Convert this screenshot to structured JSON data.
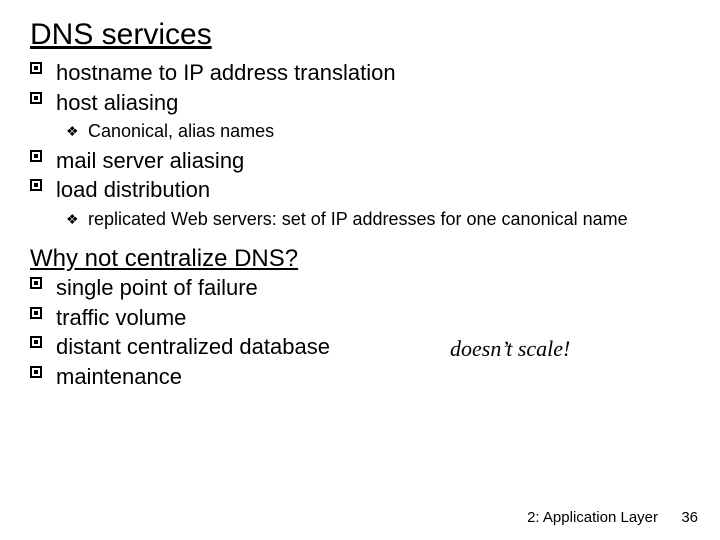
{
  "headings": {
    "h1": "DNS services",
    "h2": "Why not centralize DNS?"
  },
  "services": {
    "items": [
      {
        "text": "hostname to IP address translation"
      },
      {
        "text": "host aliasing",
        "sub": [
          "Canonical, alias names"
        ]
      },
      {
        "text": "mail server aliasing"
      },
      {
        "text": "load distribution",
        "sub": [
          "replicated Web servers: set of IP addresses for one canonical name"
        ]
      }
    ]
  },
  "centralize": {
    "items": [
      {
        "text": "single point of failure"
      },
      {
        "text": "traffic volume"
      },
      {
        "text": "distant centralized database"
      },
      {
        "text": "maintenance"
      }
    ],
    "note": "doesn’t scale!"
  },
  "footer": {
    "label": "2: Application Layer",
    "page": "36"
  }
}
